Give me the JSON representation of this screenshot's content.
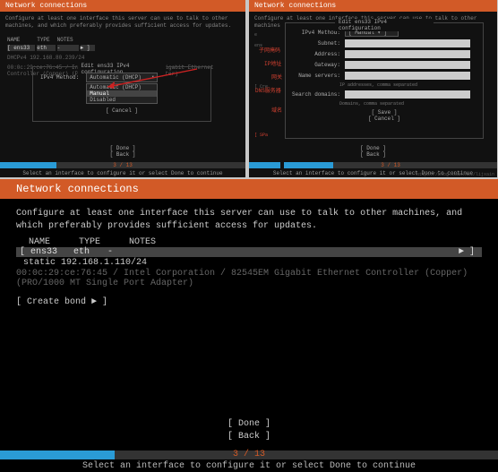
{
  "top_left": {
    "title": "Network connections",
    "desc": "Configure at least one interface this server can use to talk to other machines, and which preferably provides sufficient access for updates.",
    "table_head": {
      "name": "NAME",
      "type": "TYPE",
      "notes": "NOTES"
    },
    "iface": {
      "name": "ens33",
      "type": "eth",
      "notes": "-",
      "arrow": "►"
    },
    "static_line": "DHCPv4   192.168.80.239/24",
    "mac": "00:0c:29:ce:76:45 / Intel Corporation / 82545EM Gigabit Ethernet Controller (Copper) (PRO/1000 MT Single Port Adapter)",
    "dialog_title": "Edit ens33 IPv4 configuration",
    "method_label": "IPv4 Method:",
    "method_options": [
      "Automatic (DHCP)",
      "Manual",
      "Disabled"
    ],
    "cancel": "[ Cancel       ]",
    "done": "[ Done       ]",
    "back": "[ Back       ]",
    "progress": "3 / 13",
    "footer": "Select an interface to configure it or select Done to continue"
  },
  "top_right": {
    "title": "Network connections",
    "desc": "Configure at least one interface this server can use to talk to other machines",
    "dialog_title": "Edit ens33 IPv4 configuration",
    "method_label": "IPv4 Method:",
    "method_value": "[ Manual        ▾ ]",
    "subnet_label": "Subnet:",
    "subnet_cn": "子网掩码",
    "address_label": "Address:",
    "address_cn": "IP地址",
    "gateway_label": "Gateway:",
    "gateway_cn": "网关",
    "ns_label": "Name servers:",
    "ns_cn": "DNS服务器",
    "ns_placeholder": "IP addresses, comma separated",
    "sd_label": "Search domains:",
    "sd_cn": "域名",
    "sd_placeholder": "Domains, comma separated",
    "save": "[ Save       ]",
    "cancel": "[ Cancel       ]",
    "side_labels": {
      "b4": "e",
      "b5": "ens",
      "b6": "[ Cre",
      "tail": "[ SPa"
    },
    "done": "[ Done       ]",
    "back": "[ Back       ]",
    "progress": "3 / 13",
    "footer": "Select an interface to configure it or select Done to continue",
    "watermark": "https://blog.csdn.net/lijxain"
  },
  "bottom": {
    "title": "Network connections",
    "desc": "Configure at least one interface this server can use to talk to other machines, and which preferably provides sufficient access for updates.",
    "table_head": {
      "name": "NAME",
      "type": "TYPE",
      "notes": "NOTES"
    },
    "iface": {
      "name": "ens33",
      "type": "eth",
      "notes": "-",
      "arrow": "►"
    },
    "static_line": "static  192.168.1.110/24",
    "mac": "00:0c:29:ce:76:45 / Intel Corporation / 82545EM Gigabit Ethernet Controller (Copper) (PRO/1000 MT Single Port Adapter)",
    "create_bond": "[ Create bond ► ]",
    "done": "[ Done           ]",
    "back": "[ Back           ]",
    "progress": "3 / 13",
    "footer": "Select an interface to configure it or select Done to continue"
  }
}
